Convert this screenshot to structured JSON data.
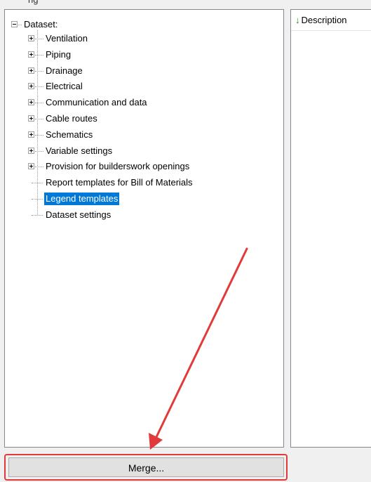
{
  "partial_top_text": "ng",
  "tree": {
    "root_label": "Dataset:",
    "items": [
      {
        "label": "Ventilation",
        "expandable": true
      },
      {
        "label": "Piping",
        "expandable": true
      },
      {
        "label": "Drainage",
        "expandable": true
      },
      {
        "label": "Electrical",
        "expandable": true
      },
      {
        "label": "Communication and data",
        "expandable": true
      },
      {
        "label": "Cable routes",
        "expandable": true
      },
      {
        "label": "Schematics",
        "expandable": true
      },
      {
        "label": "Variable settings",
        "expandable": true
      },
      {
        "label": "Provision for builderswork openings",
        "expandable": true
      },
      {
        "label": "Report templates for Bill of Materials",
        "expandable": false
      },
      {
        "label": "Legend templates",
        "expandable": false,
        "selected": true
      },
      {
        "label": "Dataset settings",
        "expandable": false
      }
    ]
  },
  "list": {
    "column_header": "Description",
    "sort_icon": "arrow-down-icon"
  },
  "buttons": {
    "merge_label": "Merge..."
  },
  "annotation": {
    "color": "#e23a3a"
  },
  "colors": {
    "selection": "#0078d7",
    "sort_arrow": "#1b8a1b"
  }
}
